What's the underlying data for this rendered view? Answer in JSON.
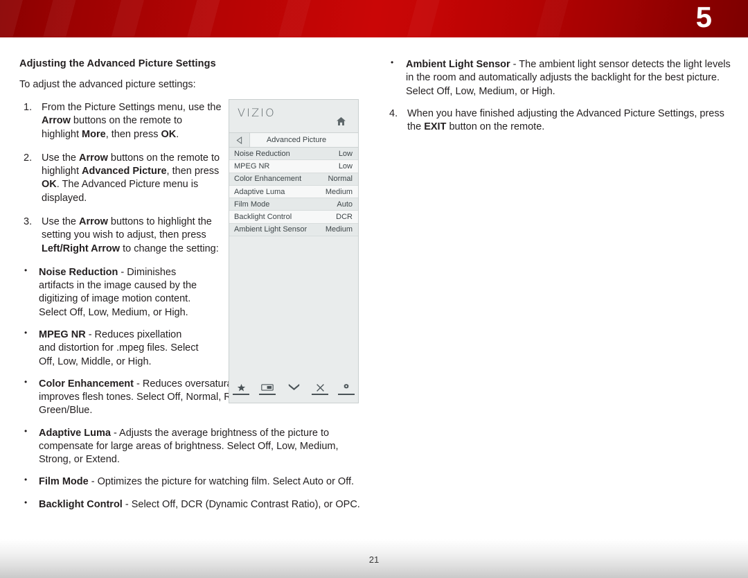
{
  "header": {
    "chapter_number": "5",
    "banner_color_left": "#8a0000",
    "banner_color_mid": "#ca0606",
    "banner_color_right": "#7d0000"
  },
  "left_column": {
    "section_title": "Adjusting the Advanced Picture Settings",
    "intro": "To adjust the advanced picture settings:",
    "steps": [
      {
        "number": "1.",
        "text_parts": [
          {
            "t": "From the Picture Settings menu, use the ",
            "b": false
          },
          {
            "t": "Arrow",
            "b": true
          },
          {
            "t": " buttons on the remote to highlight ",
            "b": false
          },
          {
            "t": "More",
            "b": true
          },
          {
            "t": ", then press ",
            "b": false
          },
          {
            "t": "OK",
            "b": true
          },
          {
            "t": ".",
            "b": false
          }
        ]
      },
      {
        "number": "2.",
        "text_parts": [
          {
            "t": "Use the ",
            "b": false
          },
          {
            "t": "Arrow",
            "b": true
          },
          {
            "t": " buttons on the remote to highlight ",
            "b": false
          },
          {
            "t": "Advanced Picture",
            "b": true
          },
          {
            "t": ", then press ",
            "b": false
          },
          {
            "t": "OK",
            "b": true
          },
          {
            "t": ". The Advanced Picture menu is displayed.",
            "b": false
          }
        ]
      },
      {
        "number": "3.",
        "text_parts": [
          {
            "t": "Use the ",
            "b": false
          },
          {
            "t": "Arrow",
            "b": true
          },
          {
            "t": " buttons to highlight the setting you wish to adjust, then press ",
            "b": false
          },
          {
            "t": "Left/Right Arrow",
            "b": true
          },
          {
            "t": " to change the setting:",
            "b": false
          }
        ]
      }
    ],
    "bullets": [
      {
        "narrow": true,
        "text_parts": [
          {
            "t": "Noise Reduction",
            "b": true
          },
          {
            "t": " - Diminishes artifacts in the image caused by the digitizing of image motion content. Select Off, Low, Medium, or High.",
            "b": false
          }
        ]
      },
      {
        "narrow": true,
        "text_parts": [
          {
            "t": "MPEG NR",
            "b": true
          },
          {
            "t": " - Reduces pixellation and distortion for .mpeg files. Select Off, Low, Middle, or High.",
            "b": false
          }
        ]
      },
      {
        "narrow": false,
        "text_parts": [
          {
            "t": "Color Enhancement",
            "b": true
          },
          {
            "t": " - Reduces oversaturation of some colors and improves flesh tones. Select Off, Normal, Rich Color, Green/Flesh, or Green/Blue.",
            "b": false
          }
        ]
      },
      {
        "narrow": false,
        "text_parts": [
          {
            "t": "Adaptive Luma",
            "b": true
          },
          {
            "t": " - Adjusts the average brightness of the picture to compensate for large areas of brightness. Select Off, Low, Medium, Strong, or Extend.",
            "b": false
          }
        ]
      },
      {
        "narrow": false,
        "text_parts": [
          {
            "t": "Film Mode",
            "b": true
          },
          {
            "t": " - Optimizes the picture for watching film. Select Auto or Off.",
            "b": false
          }
        ]
      },
      {
        "narrow": false,
        "text_parts": [
          {
            "t": "Backlight Control",
            "b": true
          },
          {
            "t": " - Select Off, DCR (Dynamic Contrast Ratio), or OPC.",
            "b": false
          }
        ]
      }
    ]
  },
  "right_column": {
    "bullets": [
      {
        "text_parts": [
          {
            "t": "Ambient Light Sensor",
            "b": true
          },
          {
            "t": " - The ambient light sensor detects the light levels in the room and automatically adjusts the backlight for the best picture. Select Off, Low, Medium, or High.",
            "b": false
          }
        ]
      }
    ],
    "steps": [
      {
        "number": "4.",
        "text_parts": [
          {
            "t": "When you have finished adjusting the Advanced Picture Settings, press the ",
            "b": false
          },
          {
            "t": "EXIT",
            "b": true
          },
          {
            "t": " button on the remote.",
            "b": false
          }
        ]
      }
    ]
  },
  "tv_menu": {
    "brand": "VIZIO",
    "home_icon": "home-icon",
    "back_icon": "back-arrow-icon",
    "breadcrumb": "Advanced Picture",
    "rows": [
      {
        "label": "Noise Reduction",
        "value": "Low",
        "shaded": true
      },
      {
        "label": "MPEG NR",
        "value": "Low",
        "shaded": false
      },
      {
        "label": "Color Enhancement",
        "value": "Normal",
        "shaded": true
      },
      {
        "label": "Adaptive Luma",
        "value": "Medium",
        "shaded": false
      },
      {
        "label": "Film Mode",
        "value": "Auto",
        "shaded": true
      },
      {
        "label": "Backlight Control",
        "value": "DCR",
        "shaded": false
      },
      {
        "label": "Ambient Light Sensor",
        "value": "Medium",
        "shaded": true
      }
    ],
    "footer_icons": [
      "star-icon",
      "picture-icon",
      "double-chevron-down-icon",
      "close-x-icon",
      "gear-icon"
    ]
  },
  "footer": {
    "page_number": "21"
  }
}
